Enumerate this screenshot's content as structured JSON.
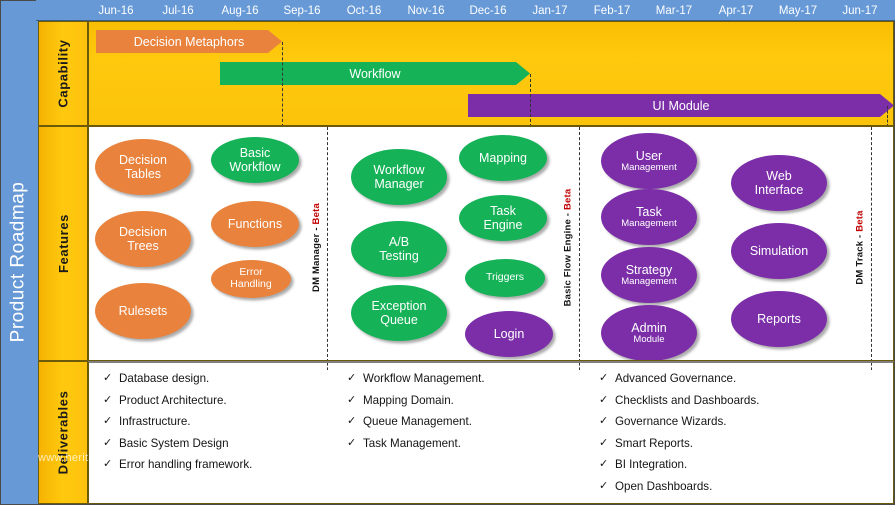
{
  "title": "Product Roadmap",
  "timeline": {
    "months": [
      "Jun-16",
      "Jul-16",
      "Aug-16",
      "Sep-16",
      "Oct-16",
      "Nov-16",
      "Dec-16",
      "Jan-17",
      "Feb-17",
      "Mar-17",
      "Apr-17",
      "May-17",
      "Jun-17"
    ]
  },
  "row_labels": {
    "capability": "Capability",
    "features": "Features",
    "deliverables": "Deliverables"
  },
  "colors": {
    "frame_blue": "#6699D6",
    "band_yellow": "#FFC90E",
    "orange": "#E8823C",
    "green": "#15B257",
    "purple": "#7B2EA8",
    "beta_red": "#C00000",
    "text_dark": "#141414"
  },
  "capability": {
    "bars": [
      {
        "label": "Decision Metaphors",
        "color": "#E8823C",
        "start_month": "Jun-16",
        "end_month": "Sep-16"
      },
      {
        "label": "Workflow",
        "color": "#15B257",
        "start_month": "Aug-16",
        "end_month": "Jan-17"
      },
      {
        "label": "UI Module",
        "color": "#7B2EA8",
        "start_month": "Dec-16",
        "end_month": "Jun-17"
      }
    ]
  },
  "tracks": [
    {
      "name": "DM Manager",
      "stage": "Beta",
      "separator": "-"
    },
    {
      "name": "Basic Flow Engine",
      "stage": "Beta",
      "separator": "-"
    },
    {
      "name": "DM Track",
      "stage": "Beta",
      "separator": "-"
    }
  ],
  "features": {
    "track1": [
      {
        "l1": "Decision",
        "l2": "Tables",
        "color": "#E8823C",
        "size": "lg"
      },
      {
        "l1": "Basic",
        "l2": "Workflow",
        "color": "#15B257",
        "size": "md"
      },
      {
        "l1": "Decision",
        "l2": "Trees",
        "color": "#E8823C",
        "size": "lg"
      },
      {
        "l1": "Functions",
        "l2": "",
        "color": "#E8823C",
        "size": "md"
      },
      {
        "l1": "Error",
        "l2": "Handling",
        "color": "#E8823C",
        "size": "sm"
      },
      {
        "l1": "Rulesets",
        "l2": "",
        "color": "#E8823C",
        "size": "lg"
      }
    ],
    "track2": [
      {
        "l1": "Workflow",
        "l2": "Manager",
        "color": "#15B257",
        "size": "lg"
      },
      {
        "l1": "Mapping",
        "l2": "",
        "color": "#15B257",
        "size": "md"
      },
      {
        "l1": "A/B",
        "l2": "Testing",
        "color": "#15B257",
        "size": "lg"
      },
      {
        "l1": "Task",
        "l2": "Engine",
        "color": "#15B257",
        "size": "md"
      },
      {
        "l1": "Triggers",
        "l2": "",
        "color": "#15B257",
        "size": "sm"
      },
      {
        "l1": "Exception",
        "l2": "Queue",
        "color": "#15B257",
        "size": "lg"
      },
      {
        "l1": "Login",
        "l2": "",
        "color": "#7B2EA8",
        "size": "md"
      }
    ],
    "track3": [
      {
        "l1": "User",
        "l2": "Management",
        "color": "#7B2EA8",
        "size": "lg"
      },
      {
        "l1": "Web",
        "l2": "Interface",
        "color": "#7B2EA8",
        "size": "lg"
      },
      {
        "l1": "Task",
        "l2": "Management",
        "color": "#7B2EA8",
        "size": "lg"
      },
      {
        "l1": "Simulation",
        "l2": "",
        "color": "#7B2EA8",
        "size": "lg"
      },
      {
        "l1": "Strategy",
        "l2": "Management",
        "color": "#7B2EA8",
        "size": "lg"
      },
      {
        "l1": "Reports",
        "l2": "",
        "color": "#7B2EA8",
        "size": "lg"
      },
      {
        "l1": "Admin",
        "l2": "Module",
        "color": "#7B2EA8",
        "size": "lg"
      }
    ]
  },
  "deliverables": {
    "check_glyph": "✓",
    "col1": [
      "Database design.",
      "Product Architecture.",
      "Infrastructure.",
      "Basic System Design",
      "Error handling framework."
    ],
    "col2": [
      "Workflow Management.",
      "Mapping Domain.",
      "Queue Management.",
      "Task Management."
    ],
    "col3": [
      "Advanced Governance.",
      "Checklists and Dashboards.",
      "Governance Wizards.",
      "Smart Reports.",
      "BI Integration.",
      "Open Dashboards."
    ]
  },
  "watermark": "www.heritage"
}
